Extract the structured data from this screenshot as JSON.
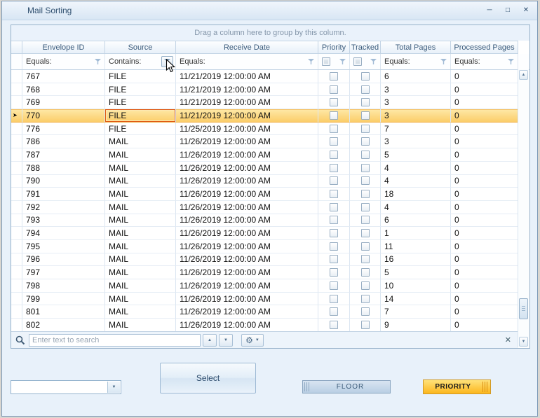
{
  "window": {
    "title": "Mail Sorting"
  },
  "icons": {
    "minimize": "─",
    "maximize": "□",
    "close": "✕",
    "up": "▲",
    "down": "▼",
    "gear": "⚙",
    "dropdown": "▼",
    "clear": "✕",
    "up_small": "▲",
    "down_small": "▼",
    "combo_arrow": "▼",
    "row_arrow": "➤"
  },
  "grid": {
    "group_panel": "Drag a column here to group by this column.",
    "columns": [
      {
        "label": "Envelope ID",
        "filter": "Equals:"
      },
      {
        "label": "Source",
        "filter": "Contains:"
      },
      {
        "label": "Receive Date",
        "filter": "Equals:"
      },
      {
        "label": "Priority",
        "filter": ""
      },
      {
        "label": "Tracked",
        "filter": ""
      },
      {
        "label": "Total Pages",
        "filter": "Equals:"
      },
      {
        "label": "Processed Pages",
        "filter": "Equals:"
      }
    ],
    "selected_row_id": "770",
    "rows": [
      {
        "id": "767",
        "source": "FILE",
        "date": "11/21/2019 12:00:00 AM",
        "priority": false,
        "tracked": false,
        "total": "6",
        "processed": "0"
      },
      {
        "id": "768",
        "source": "FILE",
        "date": "11/21/2019 12:00:00 AM",
        "priority": false,
        "tracked": false,
        "total": "3",
        "processed": "0"
      },
      {
        "id": "769",
        "source": "FILE",
        "date": "11/21/2019 12:00:00 AM",
        "priority": false,
        "tracked": false,
        "total": "3",
        "processed": "0"
      },
      {
        "id": "770",
        "source": "FILE",
        "date": "11/21/2019 12:00:00 AM",
        "priority": false,
        "tracked": false,
        "total": "3",
        "processed": "0"
      },
      {
        "id": "776",
        "source": "FILE",
        "date": "11/25/2019 12:00:00 AM",
        "priority": false,
        "tracked": false,
        "total": "7",
        "processed": "0"
      },
      {
        "id": "786",
        "source": "MAIL",
        "date": "11/26/2019 12:00:00 AM",
        "priority": false,
        "tracked": false,
        "total": "3",
        "processed": "0"
      },
      {
        "id": "787",
        "source": "MAIL",
        "date": "11/26/2019 12:00:00 AM",
        "priority": false,
        "tracked": false,
        "total": "5",
        "processed": "0"
      },
      {
        "id": "788",
        "source": "MAIL",
        "date": "11/26/2019 12:00:00 AM",
        "priority": false,
        "tracked": false,
        "total": "4",
        "processed": "0"
      },
      {
        "id": "790",
        "source": "MAIL",
        "date": "11/26/2019 12:00:00 AM",
        "priority": false,
        "tracked": false,
        "total": "4",
        "processed": "0"
      },
      {
        "id": "791",
        "source": "MAIL",
        "date": "11/26/2019 12:00:00 AM",
        "priority": false,
        "tracked": false,
        "total": "18",
        "processed": "0"
      },
      {
        "id": "792",
        "source": "MAIL",
        "date": "11/26/2019 12:00:00 AM",
        "priority": false,
        "tracked": false,
        "total": "4",
        "processed": "0"
      },
      {
        "id": "793",
        "source": "MAIL",
        "date": "11/26/2019 12:00:00 AM",
        "priority": false,
        "tracked": false,
        "total": "6",
        "processed": "0"
      },
      {
        "id": "794",
        "source": "MAIL",
        "date": "11/26/2019 12:00:00 AM",
        "priority": false,
        "tracked": false,
        "total": "1",
        "processed": "0"
      },
      {
        "id": "795",
        "source": "MAIL",
        "date": "11/26/2019 12:00:00 AM",
        "priority": false,
        "tracked": false,
        "total": "11",
        "processed": "0"
      },
      {
        "id": "796",
        "source": "MAIL",
        "date": "11/26/2019 12:00:00 AM",
        "priority": false,
        "tracked": false,
        "total": "16",
        "processed": "0"
      },
      {
        "id": "797",
        "source": "MAIL",
        "date": "11/26/2019 12:00:00 AM",
        "priority": false,
        "tracked": false,
        "total": "5",
        "processed": "0"
      },
      {
        "id": "798",
        "source": "MAIL",
        "date": "11/26/2019 12:00:00 AM",
        "priority": false,
        "tracked": false,
        "total": "10",
        "processed": "0"
      },
      {
        "id": "799",
        "source": "MAIL",
        "date": "11/26/2019 12:00:00 AM",
        "priority": false,
        "tracked": false,
        "total": "14",
        "processed": "0"
      },
      {
        "id": "801",
        "source": "MAIL",
        "date": "11/26/2019 12:00:00 AM",
        "priority": false,
        "tracked": false,
        "total": "7",
        "processed": "0"
      },
      {
        "id": "802",
        "source": "MAIL",
        "date": "11/26/2019 12:00:00 AM",
        "priority": false,
        "tracked": false,
        "total": "9",
        "processed": "0"
      }
    ]
  },
  "search": {
    "placeholder": "Enter text to search"
  },
  "footer": {
    "combo_value": "",
    "select": "Select",
    "floor": "FLOOR",
    "priority": "PRIORITY"
  }
}
